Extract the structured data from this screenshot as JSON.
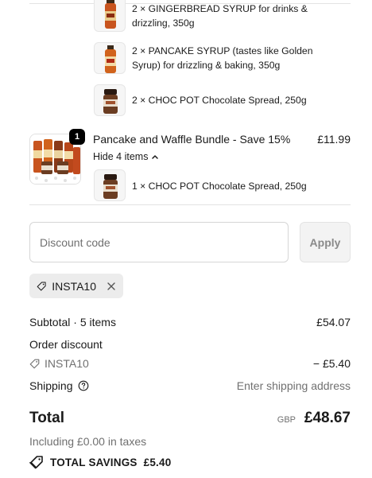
{
  "bundle_items_top": [
    {
      "label": "2 × GINGERBREAD SYRUP for drinks & drizzling, 350g",
      "image": "syrup-bottle-icon"
    },
    {
      "label": "2 × PANCAKE SYRUP (tastes like Golden Syrup) for drizzling & baking, 350g",
      "image": "syrup-bottle-icon"
    },
    {
      "label": "2 × CHOC POT Chocolate Spread, 250g",
      "image": "choc-pot-icon"
    }
  ],
  "bundle": {
    "quantity": "1",
    "title": "Pancake and Waffle Bundle - Save 15%",
    "price": "£11.99",
    "toggle_label": "Hide 4 items",
    "items": [
      {
        "label": "1 × CHOC POT Chocolate Spread, 250g",
        "image": "choc-pot-icon"
      }
    ]
  },
  "discount": {
    "placeholder": "Discount code",
    "apply_label": "Apply",
    "applied_code": "INSTA10"
  },
  "summary": {
    "subtotal_label": "Subtotal · 5 items",
    "subtotal_value": "£54.07",
    "order_discount_label": "Order discount",
    "discount_code": "INSTA10",
    "discount_value": "− £5.40",
    "shipping_label": "Shipping",
    "shipping_value": "Enter shipping address",
    "total_label": "Total",
    "currency": "GBP",
    "total_value": "£48.67",
    "taxes_note": "Including £0.00 in taxes",
    "savings_label": "TOTAL SAVINGS",
    "savings_value": "£5.40"
  },
  "colors": {
    "text": "#1a1a1a",
    "muted": "#707070",
    "chip_bg": "#ececec",
    "badge_bg": "#000000"
  }
}
